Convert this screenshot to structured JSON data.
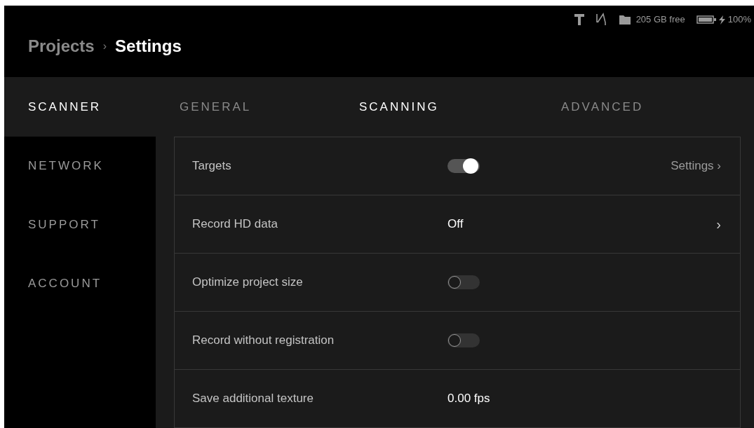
{
  "status_bar": {
    "storage": "205 GB free",
    "battery": "100%",
    "charging": true
  },
  "breadcrumb": [
    {
      "label": "Projects",
      "current": false
    },
    {
      "label": "Settings",
      "current": true
    }
  ],
  "breadcrumb_separator": "›",
  "sidebar": {
    "items": [
      {
        "label": "SCANNER",
        "selected": true
      },
      {
        "label": "NETWORK",
        "selected": false
      },
      {
        "label": "SUPPORT",
        "selected": false
      },
      {
        "label": "ACCOUNT",
        "selected": false
      }
    ]
  },
  "tabs": [
    {
      "label": "GENERAL",
      "selected": false
    },
    {
      "label": "SCANNING",
      "selected": true
    },
    {
      "label": "ADVANCED",
      "selected": false
    }
  ],
  "settings": [
    {
      "kind": "toggle",
      "label": "Targets",
      "on": true,
      "link": "Settings ›"
    },
    {
      "kind": "select",
      "label": "Record HD data",
      "value": "Off",
      "chevron": "›"
    },
    {
      "kind": "toggle",
      "label": "Optimize project size",
      "on": false
    },
    {
      "kind": "toggle",
      "label": "Record without registration",
      "on": false
    },
    {
      "kind": "value",
      "label": "Save additional texture",
      "value": "0.00 fps"
    }
  ]
}
